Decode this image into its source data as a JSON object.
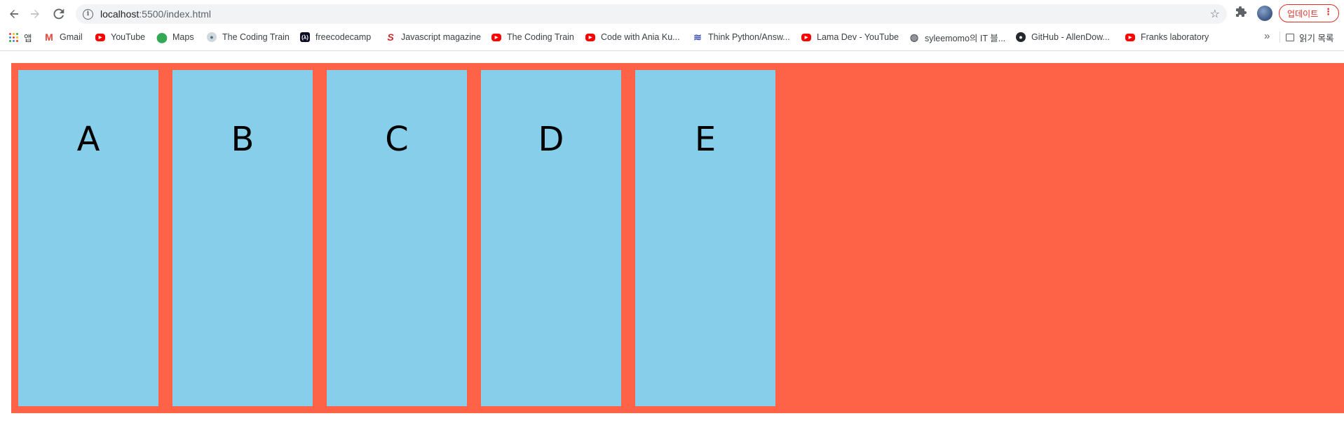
{
  "browser": {
    "url_host": "localhost",
    "url_path": ":5500/index.html",
    "update_label": "업데이트",
    "icons": {
      "back": "back-arrow-icon",
      "forward": "forward-arrow-icon",
      "reload": "reload-icon",
      "info": "info-icon",
      "bookmark_star": "star-icon",
      "extensions": "puzzle-icon",
      "menu": "kebab-menu-icon"
    },
    "update_color": "#d93025"
  },
  "bookmarks": {
    "items": [
      {
        "label": "앱",
        "icon": "apps-grid-icon"
      },
      {
        "label": "Gmail",
        "icon": "gmail-icon"
      },
      {
        "label": "YouTube",
        "icon": "youtube-icon"
      },
      {
        "label": "Maps",
        "icon": "maps-pin-icon"
      },
      {
        "label": "The Coding Train",
        "icon": "coding-train-icon"
      },
      {
        "label": "freecodecamp",
        "icon": "freecodecamp-icon"
      },
      {
        "label": "Javascript magazine",
        "icon": "javascript-magazine-icon"
      },
      {
        "label": "The Coding Train",
        "icon": "youtube-icon"
      },
      {
        "label": "Code with Ania Ku...",
        "icon": "youtube-icon"
      },
      {
        "label": "Think Python/Answ...",
        "icon": "think-python-icon"
      },
      {
        "label": "Lama Dev - YouTube",
        "icon": "youtube-icon"
      },
      {
        "label": "syleemomo의 IT 블...",
        "icon": "globe-icon"
      },
      {
        "label": "GitHub - AllenDow...",
        "icon": "github-icon"
      },
      {
        "label": "Franks laboratory",
        "icon": "youtube-icon"
      }
    ],
    "more": "»",
    "reading_list_label": "읽기 목록"
  },
  "page": {
    "container_color": "#ff6347",
    "box_color": "#87ceeb",
    "boxes": [
      "A",
      "B",
      "C",
      "D",
      "E"
    ]
  }
}
